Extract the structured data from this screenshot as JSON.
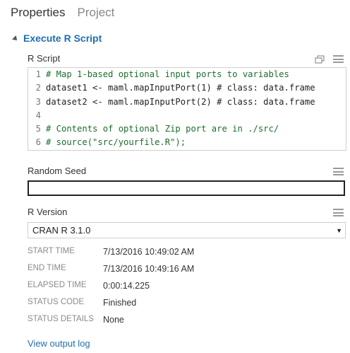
{
  "tabs": [
    {
      "label": "Properties",
      "active": true
    },
    {
      "label": "Project",
      "active": false
    }
  ],
  "section": {
    "title": "Execute R Script"
  },
  "r_script": {
    "label": "R Script",
    "lines": [
      {
        "num": "1",
        "text": "# Map 1-based optional input ports to variables",
        "kind": "comment"
      },
      {
        "num": "2",
        "text": "dataset1 <- maml.mapInputPort(1) # class: data.frame",
        "kind": "plain"
      },
      {
        "num": "3",
        "text": "dataset2 <- maml.mapInputPort(2) # class: data.frame",
        "kind": "plain"
      },
      {
        "num": "4",
        "text": "",
        "kind": "plain"
      },
      {
        "num": "5",
        "text": "# Contents of optional Zip port are in ./src/",
        "kind": "comment"
      },
      {
        "num": "6",
        "text": "# source(\"src/yourfile.R\");",
        "kind": "comment"
      }
    ]
  },
  "random_seed": {
    "label": "Random Seed",
    "value": ""
  },
  "r_version": {
    "label": "R Version",
    "selected": "CRAN R 3.1.0"
  },
  "meta": [
    {
      "key": "START TIME",
      "value": "7/13/2016 10:49:02 AM"
    },
    {
      "key": "END TIME",
      "value": "7/13/2016 10:49:16 AM"
    },
    {
      "key": "ELAPSED TIME",
      "value": "0:00:14.225"
    },
    {
      "key": "STATUS CODE",
      "value": "Finished"
    },
    {
      "key": "STATUS DETAILS",
      "value": "None"
    }
  ],
  "footer": {
    "view_log": "View output log"
  },
  "icons": {
    "section_toggle": "caret-down-icon",
    "popout": "popout-icon",
    "menu": "hamburger-icon",
    "dropdown": "chevron-down-icon"
  },
  "colors": {
    "accent": "#1f6fb0",
    "comment": "#1b6e2b"
  }
}
